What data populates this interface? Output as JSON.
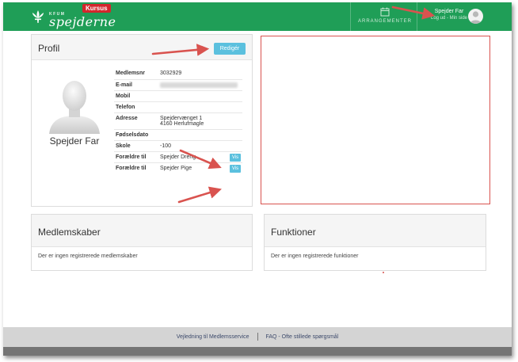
{
  "header": {
    "logo_kfum": "KFUM",
    "logo_text": "spejderne",
    "logo_badge": "Kursus",
    "events_label": "ARRANGEMENTER",
    "user_name": "Spejder Far",
    "user_links": "Log ud - Min side"
  },
  "profile": {
    "title": "Profil",
    "edit_label": "Redigér",
    "name": "Spejder Far",
    "rows": [
      {
        "label": "Medlemsnr",
        "value": "3032929"
      },
      {
        "label": "E-mail",
        "value": ""
      },
      {
        "label": "Mobil",
        "value": ""
      },
      {
        "label": "Telefon",
        "value": ""
      },
      {
        "label": "Adresse",
        "value": "Spejdervænget 1",
        "value2": "4160 Herlufmagle"
      },
      {
        "label": "Fødselsdato",
        "value": ""
      },
      {
        "label": "Skole",
        "value": "-100"
      },
      {
        "label": "Forældre til",
        "value": "Spejder Dreng",
        "button": "Vis"
      },
      {
        "label": "Forældre til",
        "value": "Spejder Pige",
        "button": "Vis"
      }
    ]
  },
  "memberships": {
    "title": "Medlemskaber",
    "empty": "Der er ingen registrerede medlemskaber"
  },
  "functions": {
    "title": "Funktioner",
    "empty": "Der er ingen registrerede funktioner"
  },
  "footer": {
    "link1": "Vejledning til Medlemsservice",
    "link2": "FAQ - Ofte stillede spørgsmål"
  },
  "colors": {
    "brand_green": "#1f9e57",
    "info_blue": "#5bc0de",
    "annotation_red": "#d9534f"
  }
}
